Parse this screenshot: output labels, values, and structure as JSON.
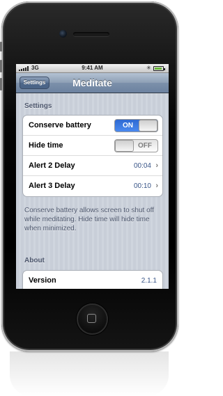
{
  "status_bar": {
    "network": "3G",
    "time": "9:41 AM",
    "battery_level": 0.9,
    "icons": [
      "signal-icon",
      "bluetooth-icon",
      "battery-icon"
    ]
  },
  "nav_bar": {
    "back_label": "Settings",
    "title": "Meditate",
    "color": "#6c82a0"
  },
  "settings_section": {
    "header": "Settings",
    "rows": [
      {
        "label": "Conserve battery",
        "control": "switch",
        "state": "ON"
      },
      {
        "label": "Hide time",
        "control": "switch",
        "state": "OFF"
      },
      {
        "label": "Alert 2 Delay",
        "value": "00:04"
      },
      {
        "label": "Alert 3 Delay",
        "value": "00:10"
      }
    ],
    "footer": "Conserve battery allows screen to shut off while meditating. Hide time will hide time when minimized."
  },
  "about_section": {
    "header": "About",
    "rows": [
      {
        "label": "Version",
        "value": "2.1.1"
      }
    ]
  },
  "colors": {
    "switch_on": "#3a7be0",
    "value_text": "#385487",
    "background": "#c8ced8"
  }
}
